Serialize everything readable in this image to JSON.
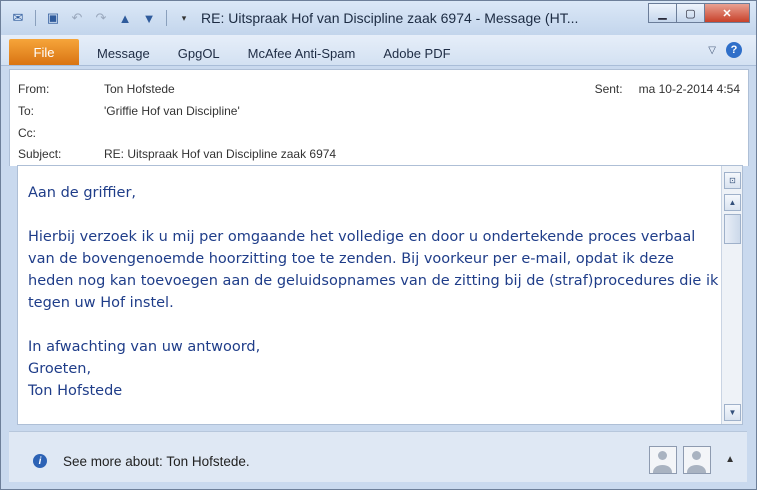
{
  "window": {
    "title": "RE: Uitspraak Hof van Discipline zaak 6974  -  Message (HT..."
  },
  "ribbon": {
    "file_label": "File",
    "tabs": [
      "Message",
      "GpgOL",
      "McAfee Anti-Spam",
      "Adobe PDF"
    ]
  },
  "header": {
    "from_label": "From:",
    "from_value": "Ton Hofstede",
    "to_label": "To:",
    "to_value": "'Griffie Hof van Discipline'",
    "cc_label": "Cc:",
    "cc_value": "",
    "subject_label": "Subject:",
    "subject_value": "RE: Uitspraak Hof van Discipline zaak 6974",
    "sent_label": "Sent:",
    "sent_value": "ma 10-2-2014 4:54"
  },
  "body": {
    "greeting": "Aan de griffier,",
    "paragraph": "Hierbij  verzoek ik u mij per omgaande het volledige en door u ondertekende proces verbaal van de bovengenoemde hoorzitting toe te zenden.  Bij voorkeur per e-mail, opdat ik deze heden nog kan toevoegen aan de geluidsopnames van de zitting bij de (straf)procedures die ik tegen uw Hof instel.",
    "closing_1": "In afwachting van uw antwoord,",
    "closing_2": "Groeten,",
    "signature": "Ton Hofstede"
  },
  "people_pane": {
    "text": "See more about: Ton Hofstede."
  },
  "colors": {
    "file_tab": "#e07c17",
    "body_text": "#1f3d89"
  }
}
